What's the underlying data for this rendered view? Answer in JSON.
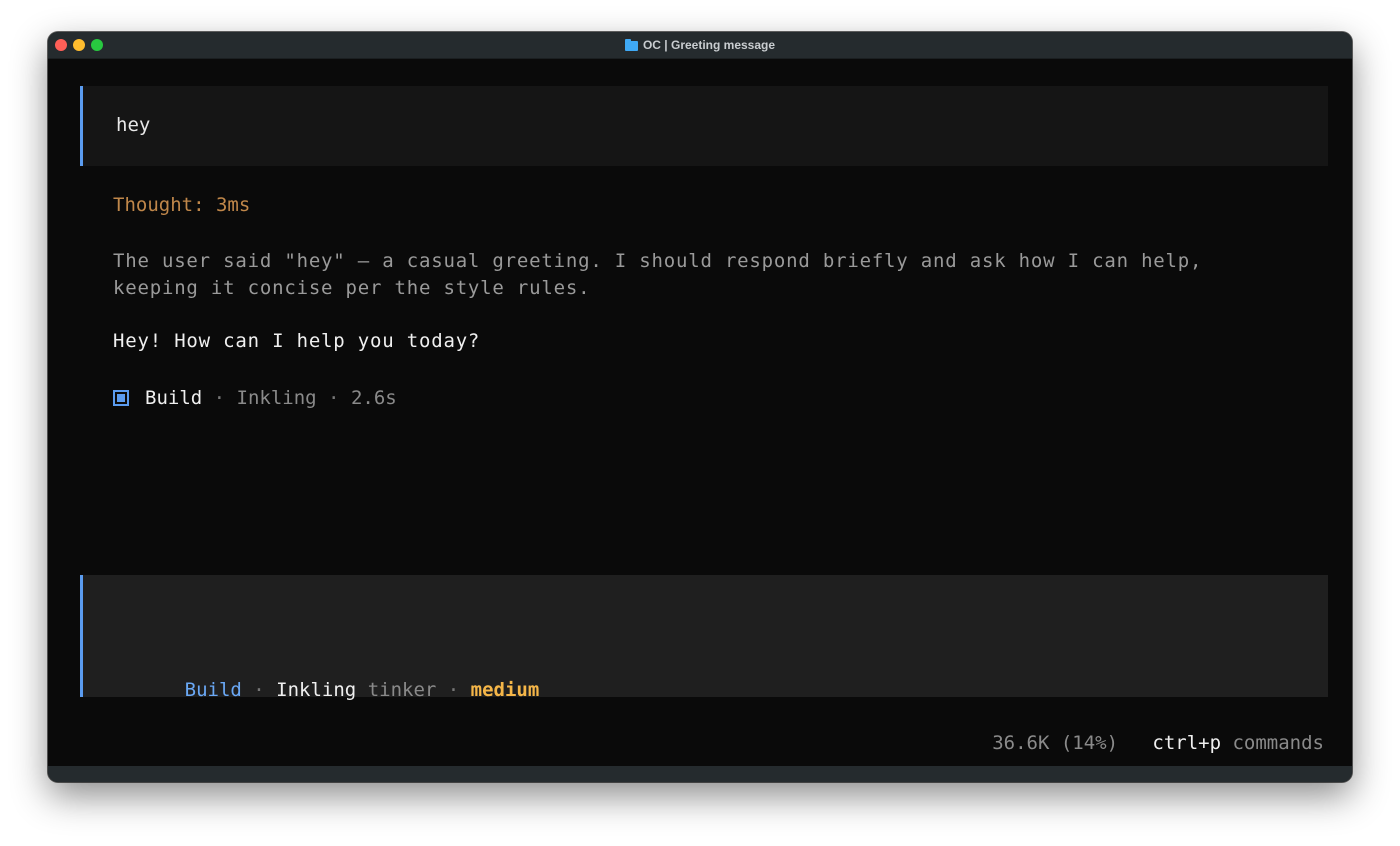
{
  "window": {
    "title": "OC | Greeting message",
    "title_icon": "folder-icon",
    "traffic_colors": {
      "close": "#fe5f57",
      "minimize": "#febc2e",
      "zoom": "#28c840"
    }
  },
  "conversation": {
    "user_message": "hey",
    "thought_label": "Thought: 3ms",
    "reasoning_lines": [
      "The user said \"hey\" — a casual greeting. I should respond briefly and ask how I can help,",
      "keeping it concise per the style rules."
    ],
    "reply": "Hey! How can I help you today?",
    "meta": {
      "icon": "square-icon",
      "agent": "Build",
      "separator": " · ",
      "model": "Inkling",
      "duration": "2.6s"
    }
  },
  "composer": {
    "agent": "Build",
    "separator": " · ",
    "model": "Inkling",
    "variant": "tinker",
    "effort": "medium"
  },
  "footer": {
    "tokens": "36.6K (14%)",
    "shortcut_key": "ctrl+p",
    "shortcut_label": "commands"
  },
  "colors": {
    "accent": "#5b9cf0",
    "thought": "#c0874a",
    "effort": "#f5b648",
    "background": "#0a0a0a"
  }
}
